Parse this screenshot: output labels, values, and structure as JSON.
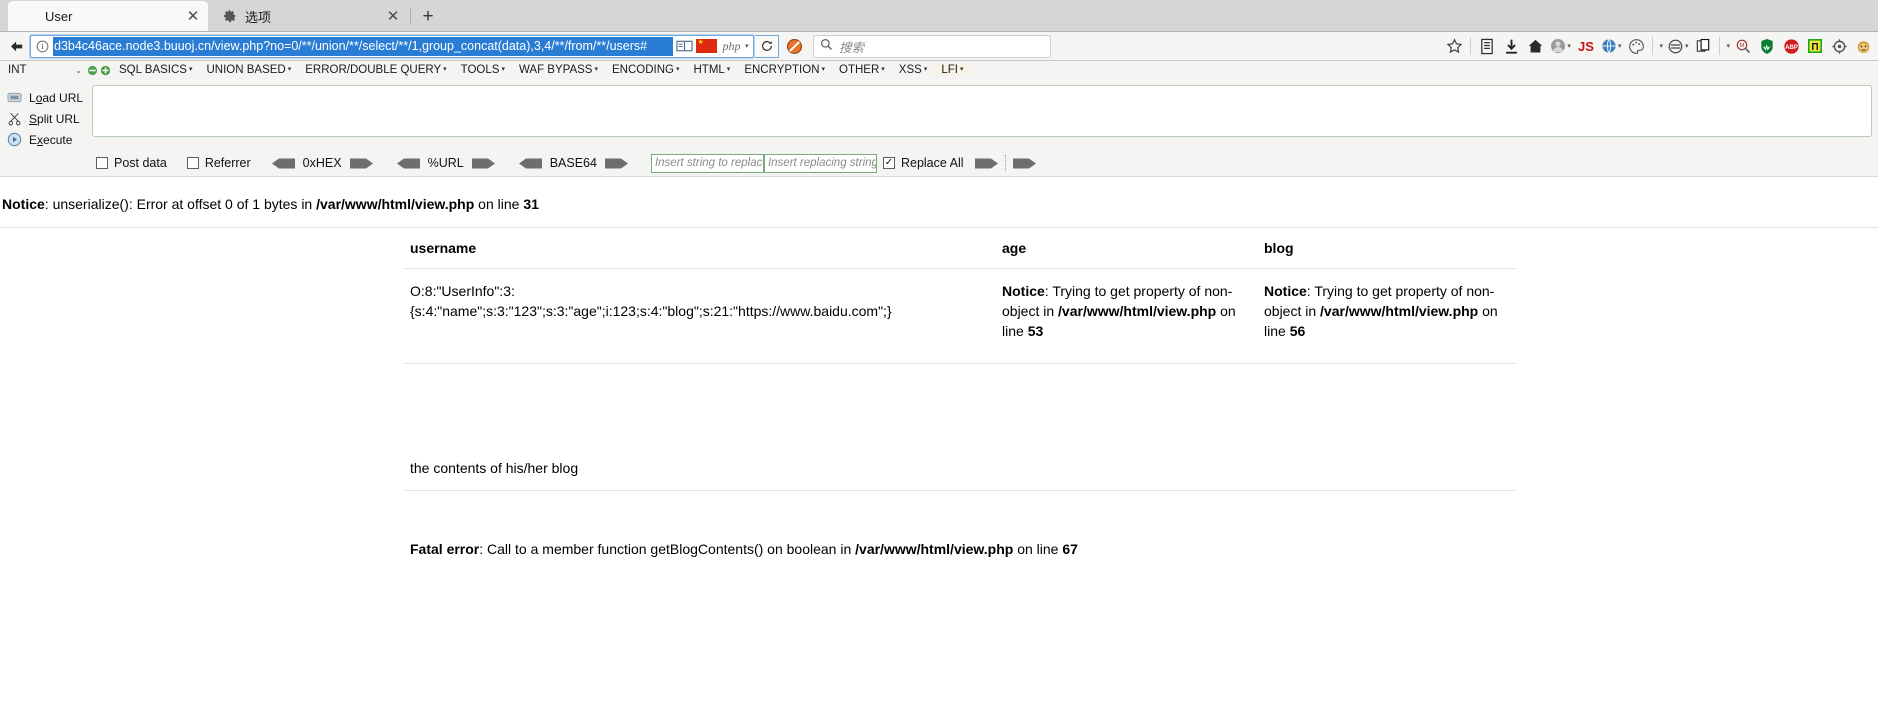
{
  "browser": {
    "tabs": [
      {
        "label": "User",
        "favicon": "none",
        "active": true,
        "close_icon": "close-icon"
      },
      {
        "label": "选项",
        "favicon": "gear-icon",
        "active": false,
        "close_icon": "close-icon"
      }
    ],
    "new_tab_label": "+",
    "nav": {
      "back_icon": "back-arrow-icon",
      "identity_icon": "info-circle-icon",
      "url": "d3b4c46ace.node3.buuoj.cn/view.php?no=0/**/union/**/select/**/1,group_concat(data),3,4/**/from/**/users#",
      "url_selected": true,
      "reader_icon": "reader-mode-icon",
      "flag_icon": "china-flag-icon",
      "php_chip_label": "php",
      "php_chip_caret": "▾",
      "reload_icon": "reload-icon",
      "blocked_icon": "no-script-blocked-icon"
    },
    "search": {
      "icon": "search-icon",
      "placeholder": "搜索",
      "value": ""
    },
    "toolbar_icons": [
      {
        "name": "bookmark-star-icon",
        "glyph": "☆",
        "color": "#3a3a3a",
        "caret": false
      },
      {
        "name": "library-icon",
        "glyph": "▤",
        "color": "#3a3a3a",
        "caret": false
      },
      {
        "name": "downloads-icon",
        "glyph": "⬇",
        "color": "#2b2b2b",
        "caret": false
      },
      {
        "name": "home-icon",
        "glyph": "⌂",
        "color": "#2b2b2b",
        "caret": false
      },
      {
        "name": "account-avatar-icon",
        "glyph": "●",
        "color": "#8b8b8b",
        "caret": true
      },
      {
        "name": "javascript-toggle-icon",
        "glyph": "JS",
        "color": "#cc1111",
        "caret": false
      },
      {
        "name": "browser-globe-icon",
        "glyph": "◉",
        "color": "#3f7fbf",
        "caret": true
      },
      {
        "name": "palette-icon",
        "glyph": "◔",
        "color": "#555555",
        "caret": true
      },
      {
        "name": "proxy-swap-icon",
        "glyph": "⬡",
        "color": "#4a4a4a",
        "caret": true
      },
      {
        "name": "copy-page-icon",
        "glyph": "❐",
        "color": "#3a3a3a",
        "caret": true
      },
      {
        "name": "zoom-search-icon",
        "glyph": "⚲",
        "color": "#a23a3a",
        "caret": false
      },
      {
        "name": "wot-shield-icon",
        "glyph": "⬟",
        "color": "#0a7d32",
        "caret": false
      },
      {
        "name": "adblock-plus-icon",
        "glyph": "ABP",
        "color": "#d01d1d",
        "caret": false
      },
      {
        "name": "proxy-flag-icon",
        "glyph": "Π",
        "color": "#2a8a2a",
        "caret": false
      },
      {
        "name": "settings-gear-icon",
        "glyph": "⚙",
        "color": "#555555",
        "caret": false
      },
      {
        "name": "monkey-userscript-icon",
        "glyph": "●",
        "color": "#c8952b",
        "caret": false
      }
    ]
  },
  "hackbar": {
    "int_label": "INT",
    "int_chevron": "⌄",
    "minus_icon": "minus-circle-icon",
    "plus_icon": "plus-circle-icon",
    "menus": [
      "SQL BASICS",
      "UNION BASED",
      "ERROR/DOUBLE QUERY",
      "TOOLS",
      "WAF BYPASS",
      "ENCODING",
      "HTML",
      "ENCRYPTION",
      "OTHER",
      "XSS",
      "LFI"
    ],
    "actions": [
      {
        "label_pre": "L",
        "label_key": "o",
        "label_post": "ad URL",
        "icon": "load-url-icon"
      },
      {
        "label_pre": "",
        "label_key": "S",
        "label_post": "plit URL",
        "icon": "split-url-icon"
      },
      {
        "label_pre": "E",
        "label_key": "x",
        "label_post": "ecute",
        "icon": "execute-icon"
      }
    ],
    "textarea_value": "",
    "options": {
      "post_data": {
        "label": "Post data",
        "checked": false
      },
      "referrer": {
        "label": "Referrer",
        "checked": false
      },
      "hex": {
        "label": "0xHEX"
      },
      "url": {
        "label": "%URL"
      },
      "base64": {
        "label": "BASE64"
      },
      "replace_search": {
        "placeholder": "Insert string to replace",
        "value": ""
      },
      "replace_with": {
        "placeholder": "Insert replacing string",
        "value": ""
      },
      "replace_all": {
        "label": "Replace All",
        "checked": true
      }
    }
  },
  "page": {
    "notice_top": {
      "label": "Notice",
      "text": ": unserialize(): Error at offset 0 of 1 bytes in ",
      "file": "/var/www/html/view.php",
      "on_line": " on line ",
      "line": "31"
    },
    "table": {
      "headers": [
        "username",
        "age",
        "blog"
      ],
      "row": {
        "username": "O:8:\"UserInfo\":3:{s:4:\"name\";s:3:\"123\";s:3:\"age\";i:123;s:4:\"blog\";s:21:\"https://www.baidu.com\";}",
        "age": {
          "label": "Notice",
          "text": ": Trying to get property of non-object in ",
          "file": "/var/www/html/view.php",
          "on_line": " on line ",
          "line": "53"
        },
        "blog": {
          "label": "Notice",
          "text": ": Trying to get property of non-object in ",
          "file": "/var/www/html/view.php",
          "on_line": " on line ",
          "line": "56"
        }
      }
    },
    "blog_caption": "the contents of his/her blog",
    "fatal": {
      "label": "Fatal error",
      "text": ": Call to a member function getBlogContents() on boolean in ",
      "file": "/var/www/html/view.php",
      "on_line": " on line ",
      "line": "67"
    }
  },
  "colors": {
    "tab_active_bg": "#f9f9f9",
    "tabstrip_bg": "#d6d6d4",
    "url_selection": "#2a7dd4",
    "hackbar_bg": "#f4f4f2",
    "input_border_green": "#7aa97a"
  }
}
